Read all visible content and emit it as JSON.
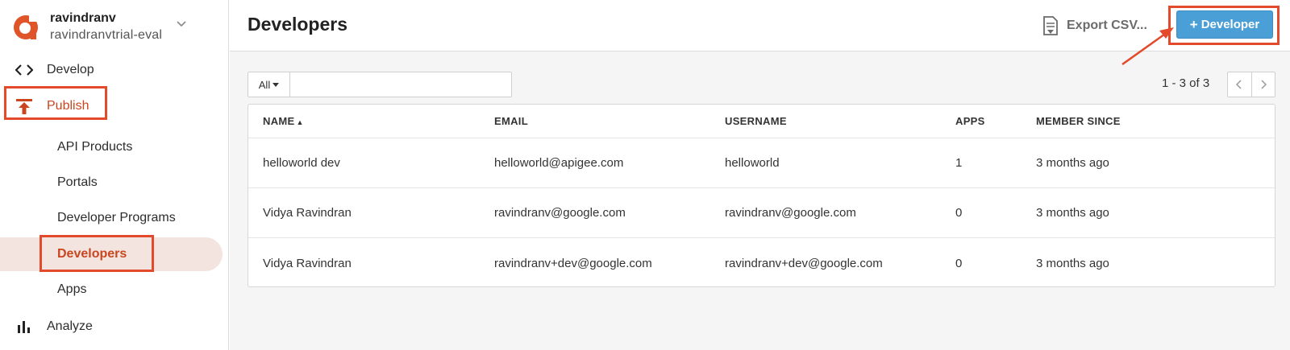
{
  "org": {
    "name": "ravindranv",
    "subname": "ravindranvtrial-eval",
    "logo_icon": "apigee-logo-icon",
    "brand_color": "#e0542a"
  },
  "nav": {
    "develop": "Develop",
    "publish": "Publish",
    "analyze": "Analyze",
    "publish_items": [
      {
        "label": "API Products"
      },
      {
        "label": "Portals"
      },
      {
        "label": "Developer Programs"
      },
      {
        "label": "Developers",
        "active": true
      },
      {
        "label": "Apps"
      }
    ]
  },
  "header": {
    "title": "Developers",
    "export_label": "Export CSV...",
    "add_label": "Developer",
    "add_color": "#4a9fd6"
  },
  "filter": {
    "select_value": "All",
    "search_value": "",
    "search_placeholder": ""
  },
  "pager": {
    "text": "1 - 3 of 3"
  },
  "table": {
    "columns": [
      "NAME",
      "EMAIL",
      "USERNAME",
      "APPS",
      "MEMBER SINCE"
    ],
    "sort_indicator": "▲",
    "rows": [
      [
        "helloworld dev",
        "helloworld@apigee.com",
        "helloworld",
        "1",
        "3 months ago"
      ],
      [
        "Vidya Ravindran",
        "ravindranv@google.com",
        "ravindranv@google.com",
        "0",
        "3 months ago"
      ],
      [
        "Vidya Ravindran",
        "ravindranv+dev@google.com",
        "ravindranv+dev@google.com",
        "0",
        "3 months ago"
      ]
    ]
  },
  "highlight_color": "#e24a2b"
}
